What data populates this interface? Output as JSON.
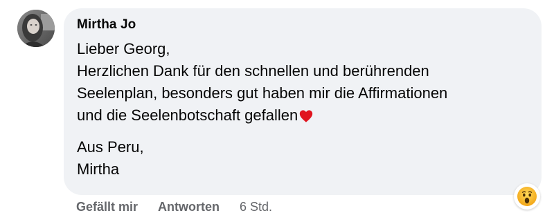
{
  "comment": {
    "author": "Mirtha Jo",
    "lines": [
      "Lieber Georg,",
      "Herzlichen Dank für den schnellen und berührenden",
      "Seelenplan, besonders gut haben mir die Affirmationen",
      "und die Seelenbotschaft gefallen"
    ],
    "closing": [
      "Aus Peru,",
      "Mirtha"
    ],
    "inline_emoji": "heart-icon",
    "reaction_emoji": "wow-reaction-icon"
  },
  "actions": {
    "like_label": "Gefällt mir",
    "reply_label": "Antworten",
    "timestamp": "6 Std."
  },
  "colors": {
    "bubble_background": "#f0f2f5",
    "secondary_text": "#65676b",
    "heart": "#e0141e",
    "reaction_yellow": "#f7b125"
  }
}
